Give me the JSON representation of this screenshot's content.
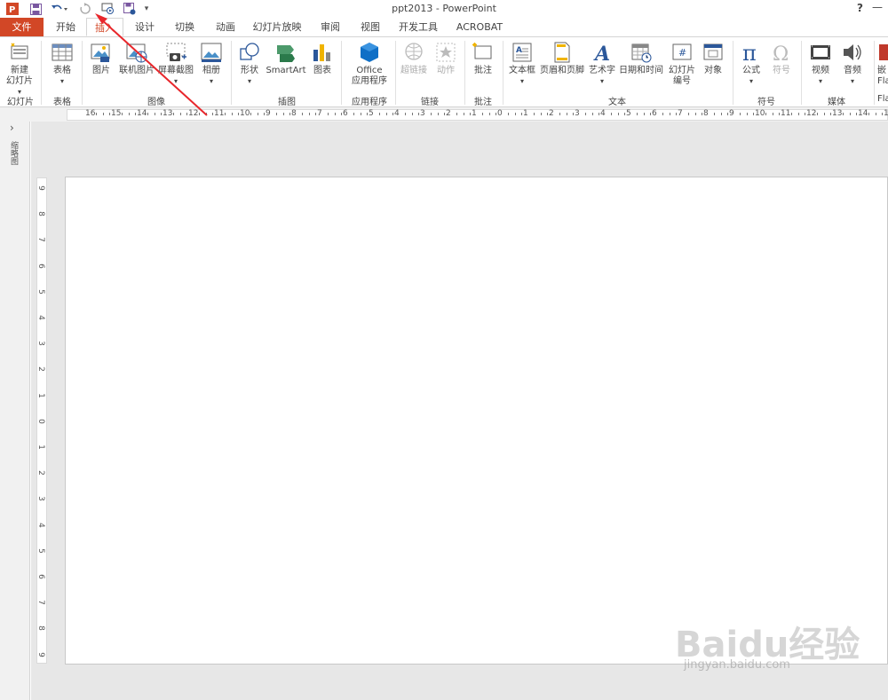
{
  "window": {
    "title": "ppt2013 - PowerPoint",
    "help": "?",
    "minimize": "—"
  },
  "tabs": [
    "文件",
    "开始",
    "插入",
    "设计",
    "切换",
    "动画",
    "幻灯片放映",
    "审阅",
    "视图",
    "开发工具",
    "ACROBAT"
  ],
  "active_tab": "插入",
  "ribbon": {
    "commands": {
      "new_slide": "新建\n幻灯片",
      "table": "表格",
      "picture": "图片",
      "online_picture": "联机图片",
      "screenshot": "屏幕截图",
      "album": "相册",
      "shapes": "形状",
      "smartart": "SmartArt",
      "chart": "图表",
      "office_apps_1": "Office",
      "office_apps_2": "应用程序",
      "hyperlink": "超链接",
      "action": "动作",
      "comment": "批注",
      "textbox": "文本框",
      "header_footer": "页眉和页脚",
      "wordart": "艺术字",
      "datetime": "日期和时间",
      "slide_number_1": "幻灯片",
      "slide_number_2": "编号",
      "object": "对象",
      "equation": "公式",
      "symbol": "符号",
      "video": "视频",
      "audio": "音频",
      "flash_1": "嵌",
      "flash_2": "Fla"
    },
    "groups": {
      "slides": "幻灯片",
      "tables": "表格",
      "images": "图像",
      "illustrations": "插图",
      "apps": "应用程序",
      "links": "链接",
      "comments": "批注",
      "text": "文本",
      "symbols": "符号",
      "media": "媒体",
      "flash": "Fla"
    }
  },
  "ruler": {
    "horizontal": [
      "16",
      "15",
      "14",
      "13",
      "12",
      "11",
      "10",
      "9",
      "8",
      "7",
      "6",
      "5",
      "4",
      "3",
      "2",
      "1",
      "0",
      "1",
      "2",
      "3",
      "4",
      "5",
      "6",
      "7",
      "8",
      "9",
      "10",
      "11",
      "12",
      "13",
      "14",
      "15"
    ],
    "vertical": [
      "9",
      "8",
      "7",
      "6",
      "5",
      "4",
      "3",
      "2",
      "1",
      "0",
      "1",
      "2",
      "3",
      "4",
      "5",
      "6",
      "7",
      "8",
      "9"
    ]
  },
  "thumbnails": {
    "label": "缩略图",
    "toggle": "›"
  },
  "watermark": {
    "brand": "Baidu经验",
    "url": "jingyan.baidu.com"
  },
  "colors": {
    "accent": "#d24726",
    "arrow": "#e8262b"
  }
}
